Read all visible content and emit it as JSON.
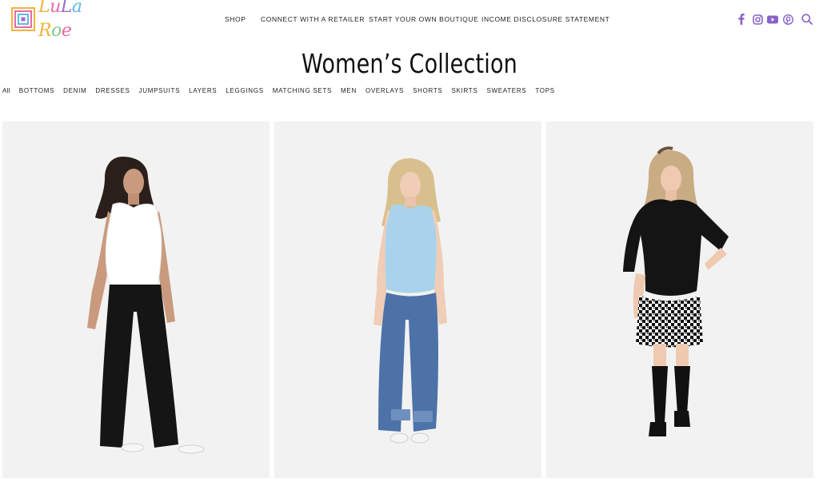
{
  "brand": {
    "name": "LuLaRoe",
    "letters": [
      "L",
      "u",
      "L",
      "a",
      "R",
      "o",
      "e"
    ],
    "letter_colors": [
      "#f2b23a",
      "#e96aa6",
      "#9b6fd1",
      "#5fb8e6",
      "#f2b23a",
      "#7cc98b",
      "#e96aa6"
    ]
  },
  "nav": {
    "shop": "SHOP",
    "connect": "CONNECT WITH A RETAILER",
    "start": "START YOUR OWN BOUTIQUE",
    "income": "INCOME DISCLOSURE STATEMENT"
  },
  "social": {
    "icons": [
      "facebook-icon",
      "instagram-icon",
      "youtube-icon",
      "pinterest-icon",
      "search-icon"
    ],
    "color": "#8a63c9"
  },
  "page": {
    "title": "Women’s Collection"
  },
  "filters": [
    {
      "label": "All",
      "active": true
    },
    {
      "label": "BOTTOMS"
    },
    {
      "label": "DENIM"
    },
    {
      "label": "DRESSES"
    },
    {
      "label": "JUMPSUITS"
    },
    {
      "label": "LAYERS"
    },
    {
      "label": "LEGGINGS"
    },
    {
      "label": "MATCHING SETS"
    },
    {
      "label": "MEN"
    },
    {
      "label": "OVERLAYS"
    },
    {
      "label": "SHORTS"
    },
    {
      "label": "SKIRTS"
    },
    {
      "label": "SWEATERS"
    },
    {
      "label": "TOPS"
    }
  ],
  "products": [
    {
      "image": "model-white-tank-black-wide-pants"
    },
    {
      "image": "model-light-blue-tank-blue-jeans"
    },
    {
      "image": "model-black-top-houndstooth-skirt"
    }
  ]
}
